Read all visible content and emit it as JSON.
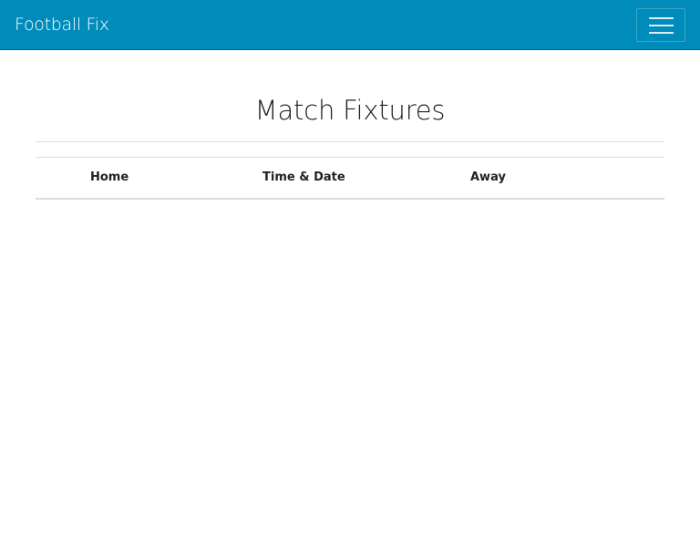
{
  "navbar": {
    "brand": "Football Fix",
    "toggler_icon": "hamburger-menu-icon",
    "background_color": "#008cba"
  },
  "main": {
    "title": "Match Fixtures",
    "table": {
      "columns": [
        "Home",
        "Time & Date",
        "Away"
      ],
      "rows": []
    }
  }
}
